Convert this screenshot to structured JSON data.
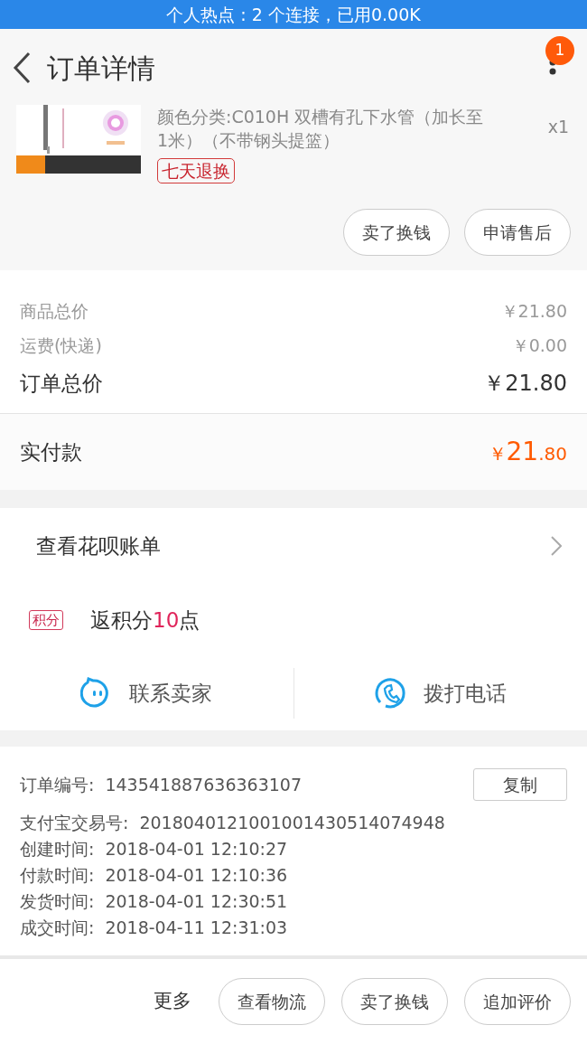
{
  "status_bar": {
    "text": "个人热点 : 2 个连接，已用0.00K"
  },
  "header": {
    "title": "订单详情",
    "badge": "1"
  },
  "product": {
    "description": "颜色分类:C010H 双槽有孔下水管（加长至1米）（不带钢头提篮）",
    "quantity": "x1",
    "tag": "七天退换"
  },
  "product_actions": [
    "卖了换钱",
    "申请售后"
  ],
  "prices": [
    {
      "kind": "minor",
      "label": "商品总价",
      "value": "￥21.80"
    },
    {
      "kind": "minor",
      "label": "运费(快递)",
      "value": "￥0.00"
    },
    {
      "kind": "major",
      "label": "订单总价",
      "value": "￥21.80"
    }
  ],
  "paid": {
    "label": "实付款",
    "currency": "￥",
    "integer": "21",
    "decimal": ".80"
  },
  "huabei": {
    "label": "查看花呗账单"
  },
  "points": {
    "tag": "积分",
    "prefix": "返积分",
    "amount": "10",
    "suffix": "点"
  },
  "contacts": [
    {
      "kind": "chat",
      "label": "联系卖家"
    },
    {
      "kind": "phone",
      "label": "拨打电话"
    }
  ],
  "order_info": [
    {
      "label": "订单编号:",
      "value": "143541887636363107",
      "action": "复制"
    },
    {
      "label": "支付宝交易号:",
      "value": "2018040121001001430514074948"
    },
    {
      "label": "创建时间:",
      "value": "2018-04-01 12:10:27"
    },
    {
      "label": "付款时间:",
      "value": "2018-04-01 12:10:36"
    },
    {
      "label": "发货时间:",
      "value": "2018-04-01 12:30:51"
    },
    {
      "label": "成交时间:",
      "value": "2018-04-11 12:31:03"
    }
  ],
  "bottom_bar": {
    "more": "更多",
    "buttons": [
      "查看物流",
      "卖了换钱",
      "追加评价"
    ]
  }
}
